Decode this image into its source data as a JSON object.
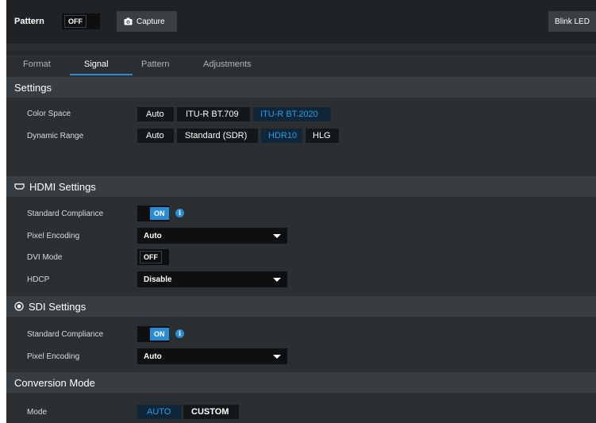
{
  "topbar": {
    "pattern_label": "Pattern",
    "pattern_toggle": "OFF",
    "capture_label": "Capture",
    "blink_label": "Blink LED"
  },
  "tabs": [
    {
      "label": "Format"
    },
    {
      "label": "Signal",
      "active": true
    },
    {
      "label": "Pattern"
    },
    {
      "label": "Adjustments"
    }
  ],
  "settings": {
    "title": "Settings",
    "color_space": {
      "label": "Color Space",
      "options": [
        "Auto",
        "ITU-R BT.709",
        "ITU-R BT.2020"
      ],
      "selected": "ITU-R BT.2020"
    },
    "dynamic_range": {
      "label": "Dynamic Range",
      "options": [
        "Auto",
        "Standard (SDR)",
        "HDR10",
        "HLG"
      ],
      "selected": "HDR10"
    }
  },
  "hdmi": {
    "title": "HDMI Settings",
    "standard_compliance": {
      "label": "Standard Compliance",
      "value": "ON"
    },
    "pixel_encoding": {
      "label": "Pixel Encoding",
      "value": "Auto"
    },
    "dvi_mode": {
      "label": "DVI Mode",
      "value": "OFF"
    },
    "hdcp": {
      "label": "HDCP",
      "value": "Disable"
    }
  },
  "sdi": {
    "title": "SDI Settings",
    "standard_compliance": {
      "label": "Standard Compliance",
      "value": "ON"
    },
    "pixel_encoding": {
      "label": "Pixel Encoding",
      "value": "Auto"
    }
  },
  "conversion": {
    "title": "Conversion Mode",
    "mode": {
      "label": "Mode",
      "options": [
        "AUTO",
        "CUSTOM"
      ],
      "selected": "AUTO"
    }
  },
  "colors": {
    "accent": "#2a8bd6",
    "panel": "#2b2f32",
    "section": "#383d41"
  }
}
